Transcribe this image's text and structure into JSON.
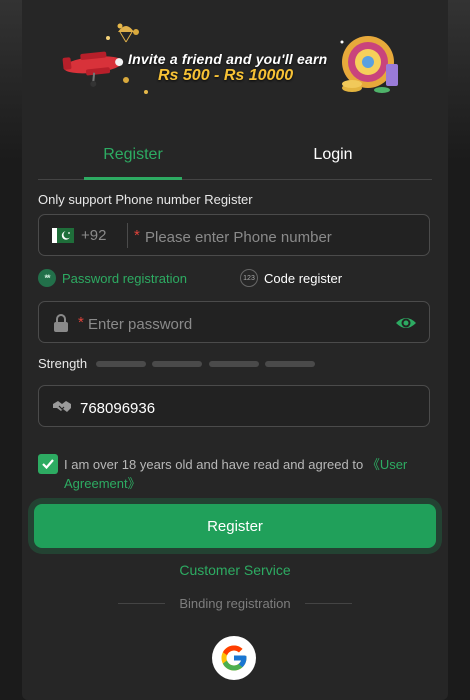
{
  "banner": {
    "line1": "Invite a friend and you'll earn",
    "line2": "Rs 500 - Rs 10000"
  },
  "tabs": [
    {
      "label": "Register",
      "active": true
    },
    {
      "label": "Login",
      "active": false
    }
  ],
  "register_note": "Only support Phone number Register",
  "phone": {
    "country_code": "+92",
    "required_mark": "*",
    "placeholder": "Please enter Phone number",
    "value": ""
  },
  "options": {
    "password_icon_text": "**",
    "password_label": "Password registration",
    "code_icon_text": "123",
    "code_label": "Code register",
    "selected": "password"
  },
  "password": {
    "required_mark": "*",
    "placeholder": "Enter password",
    "value": ""
  },
  "strength": {
    "label": "Strength",
    "segments": 4,
    "filled": 0
  },
  "invite_code": {
    "value": "768096936"
  },
  "agreement": {
    "checked": true,
    "text": "I am over 18 years old and have read and agreed to ",
    "link": "《User Agreement》"
  },
  "register_button": "Register",
  "customer_service": "Customer Service",
  "binding_label": "Binding registration",
  "colors": {
    "accent": "#2dab62",
    "panel": "#262626",
    "required": "#e0433a",
    "banner_amount": "#f7c236"
  },
  "icons": [
    "pakistan-flag-icon",
    "lock-icon",
    "eye-icon",
    "handshake-icon",
    "check-icon",
    "google-icon"
  ]
}
